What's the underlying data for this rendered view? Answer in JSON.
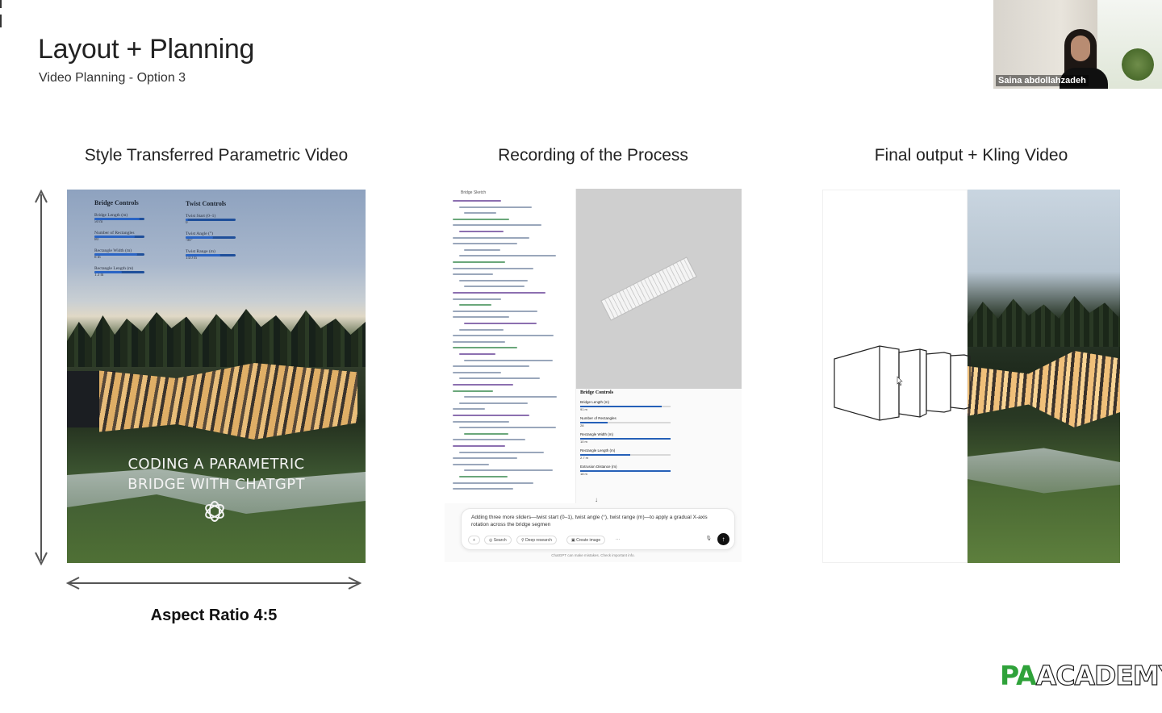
{
  "slide": {
    "title": "Layout + Planning",
    "subtitle": "Video Planning - Option 3"
  },
  "participant": {
    "name": "Saina abdollahzadeh"
  },
  "columns": [
    {
      "heading": "Style Transferred Parametric Video"
    },
    {
      "heading": "Recording of the Process"
    },
    {
      "heading": "Final output + Kling Video"
    }
  ],
  "panel1": {
    "bridge_controls_title": "Bridge Controls",
    "twist_controls_title": "Twist Controls",
    "bridge_sliders": [
      {
        "label": "Bridge Length (m)",
        "value": "50 m",
        "level": 0.9
      },
      {
        "label": "Number of Rectangles",
        "value": "80",
        "level": 0.8
      },
      {
        "label": "Rectangle Width (m)",
        "value": "8 m",
        "level": 0.85
      },
      {
        "label": "Rectangle Length (m)",
        "value": "1.3 m",
        "level": 0.55
      }
    ],
    "twist_sliders": [
      {
        "label": "Twist Start (0–1)",
        "value": "0",
        "level": 0.05
      },
      {
        "label": "Twist Angle (°)",
        "value": "-90°",
        "level": 0.55
      },
      {
        "label": "Twist Range (m)",
        "value": "14.0 m",
        "level": 0.7
      }
    ],
    "caption_line1": "CODING A PARAMETRIC",
    "caption_line2": "BRIDGE WITH CHATGPT",
    "aspect_ratio_label": "Aspect Ratio 4:5"
  },
  "panel2": {
    "sketch_tab": "Bridge Sketch",
    "controls_title": "Bridge Controls",
    "sliders": [
      {
        "label": "Bridge Length (m)",
        "value": "91 m",
        "level": 0.9
      },
      {
        "label": "Number of Rectangles",
        "value": "28",
        "level": 0.3
      },
      {
        "label": "Rectangle Width (m)",
        "value": "10 m",
        "level": 1.0
      },
      {
        "label": "Rectangle Length (m)",
        "value": "2.7 m",
        "level": 0.55
      },
      {
        "label": "Extrusion Distance (m)",
        "value": "18 m",
        "level": 1.0
      }
    ],
    "chat_message": "Adding three more sliders—twist start (0–1), twist angle (°), twist range (m)—to apply a gradual X-axis rotation across the bridge segmen",
    "chat_buttons": [
      "Search",
      "Deep research",
      "Create image"
    ],
    "disclaimer": "ChatGPT can make mistakes. Check important info."
  },
  "brand": {
    "part1": "PA",
    "part2": "ACADEMY",
    "colors": {
      "green": "#2fa23a",
      "outline": "#1b1b1b"
    }
  }
}
